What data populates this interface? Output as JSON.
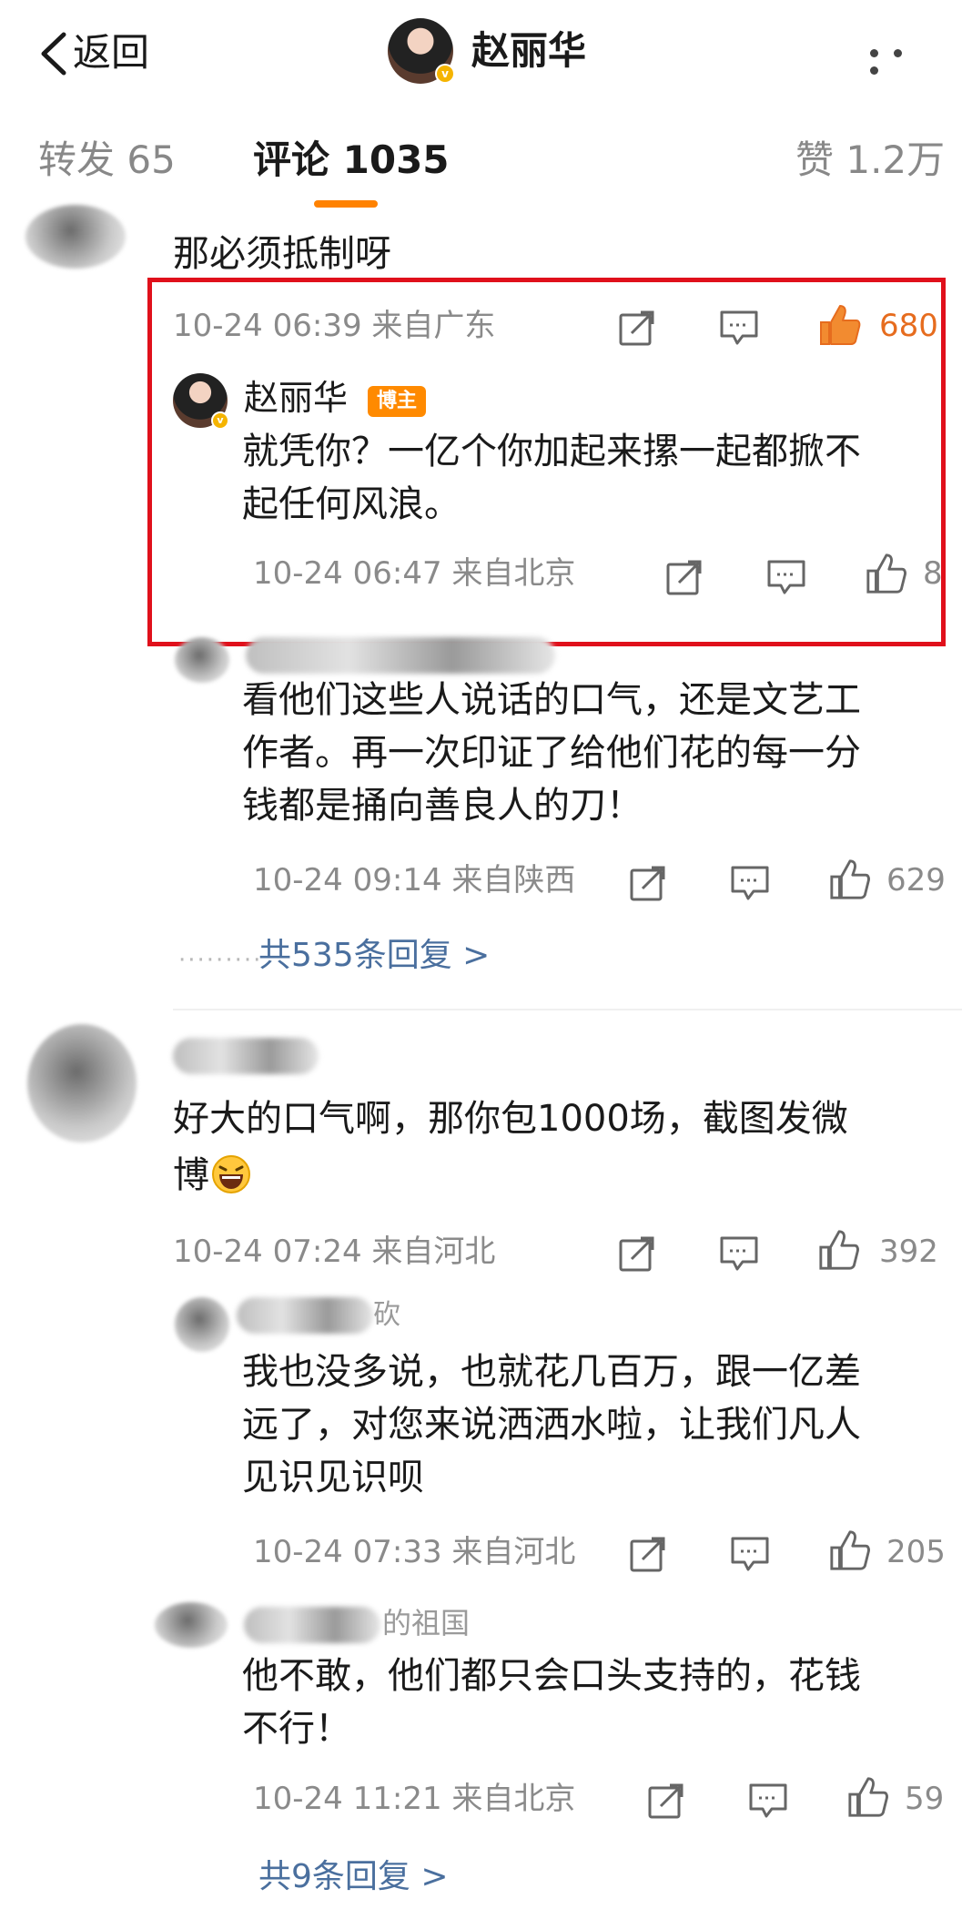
{
  "header": {
    "back_label": "返回",
    "title": "赵丽华"
  },
  "tabs": {
    "repost": "转发 65",
    "comments": "评论 1035",
    "likes": "赞 1.2万"
  },
  "comments": [
    {
      "text": "那必须抵制呀",
      "meta": "10-24 06:39 来自广东",
      "likes": "680",
      "liked": true,
      "replies": [
        {
          "name": "赵丽华",
          "badge": "博主",
          "text_line1": "就凭你？一亿个你加起来摞一起都掀不",
          "text_line2": "起任何风浪。",
          "meta": "10-24 06:47 来自北京",
          "likes": "8"
        },
        {
          "text_line1": "看他们这些人说话的口气，还是文艺工",
          "text_line2": "作者。再一次印证了给他们花的每一分",
          "text_line3": "钱都是捅向善良人的刀！",
          "meta": "10-24 09:14 来自陕西",
          "likes": "629"
        }
      ],
      "more_replies": "共535条回复 >"
    },
    {
      "text_line1": "好大的口气啊，那你包1000场，截图发微",
      "text_line2": "博",
      "meta": "10-24 07:24 来自河北",
      "likes": "392",
      "replies": [
        {
          "name_fragment": "砍",
          "text_line1": "我也没多说，也就花几百万，跟一亿差",
          "text_line2": "远了，对您来说洒洒水啦，让我们凡人",
          "text_line3": "见识见识呗",
          "meta": "10-24 07:33 来自河北",
          "likes": "205"
        },
        {
          "name_fragment": "的祖国",
          "text_line1": "他不敢，他们都只会口头支持的，花钱",
          "text_line2": "不行！",
          "meta": "10-24 11:21 来自北京",
          "likes": "59"
        }
      ],
      "more_replies": "共9条回复 >"
    }
  ],
  "colors": {
    "accent_orange": "#ff8200",
    "like_active": "#e66c1e",
    "link_blue": "#4a6f9e",
    "highlight_red": "#e0101b",
    "meta_gray": "#8a8a8a"
  },
  "icons": [
    "back-chevron-icon",
    "more-icon",
    "share-icon",
    "comment-icon",
    "like-icon",
    "laugh-emoji-icon",
    "verified-badge-icon"
  ]
}
